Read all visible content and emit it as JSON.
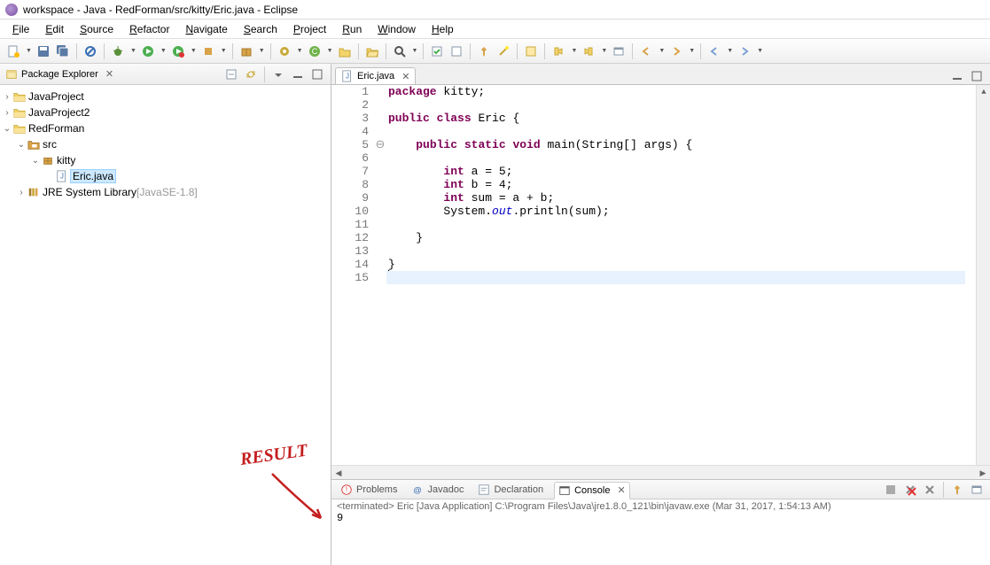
{
  "window": {
    "title": "workspace - Java - RedForman/src/kitty/Eric.java - Eclipse"
  },
  "menu": [
    "File",
    "Edit",
    "Source",
    "Refactor",
    "Navigate",
    "Search",
    "Project",
    "Run",
    "Window",
    "Help"
  ],
  "views": {
    "package_explorer": {
      "title": "Package Explorer"
    }
  },
  "tree": {
    "projects": [
      {
        "name": "JavaProject",
        "expanded": false
      },
      {
        "name": "JavaProject2",
        "expanded": false
      },
      {
        "name": "RedForman",
        "expanded": true,
        "children": [
          {
            "name": "src",
            "type": "srcfolder",
            "expanded": true,
            "children": [
              {
                "name": "kitty",
                "type": "package",
                "expanded": true,
                "children": [
                  {
                    "name": "Eric.java",
                    "type": "cu",
                    "selected": true
                  }
                ]
              }
            ]
          },
          {
            "name": "JRE System Library",
            "lib": "[JavaSE-1.8]",
            "type": "lib",
            "expanded": false
          }
        ]
      }
    ]
  },
  "editor": {
    "tab": "Eric.java",
    "code_lines": [
      {
        "n": 1,
        "tokens": [
          [
            "kw",
            "package"
          ],
          [
            "",
            " kitty;"
          ]
        ]
      },
      {
        "n": 2,
        "tokens": []
      },
      {
        "n": 3,
        "tokens": [
          [
            "kw",
            "public"
          ],
          [
            "",
            " "
          ],
          [
            "kw",
            "class"
          ],
          [
            "",
            " Eric {"
          ]
        ]
      },
      {
        "n": 4,
        "tokens": []
      },
      {
        "n": 5,
        "tokens": [
          [
            "",
            "    "
          ],
          [
            "kw",
            "public"
          ],
          [
            "",
            " "
          ],
          [
            "kw",
            "static"
          ],
          [
            "",
            " "
          ],
          [
            "kw",
            "void"
          ],
          [
            "",
            " main(String[] args) {"
          ]
        ],
        "fold": true
      },
      {
        "n": 6,
        "tokens": []
      },
      {
        "n": 7,
        "tokens": [
          [
            "",
            "        "
          ],
          [
            "kw",
            "int"
          ],
          [
            "",
            " a = 5;"
          ]
        ]
      },
      {
        "n": 8,
        "tokens": [
          [
            "",
            "        "
          ],
          [
            "kw",
            "int"
          ],
          [
            "",
            " b = 4;"
          ]
        ]
      },
      {
        "n": 9,
        "tokens": [
          [
            "",
            "        "
          ],
          [
            "kw",
            "int"
          ],
          [
            "",
            " sum = a + b;"
          ]
        ]
      },
      {
        "n": 10,
        "tokens": [
          [
            "",
            "        System."
          ],
          [
            "field",
            "out"
          ],
          [
            "",
            ".println(sum);"
          ]
        ]
      },
      {
        "n": 11,
        "tokens": []
      },
      {
        "n": 12,
        "tokens": [
          [
            "",
            "    }"
          ]
        ]
      },
      {
        "n": 13,
        "tokens": []
      },
      {
        "n": 14,
        "tokens": [
          [
            "",
            "}"
          ]
        ]
      },
      {
        "n": 15,
        "tokens": [],
        "cursor": true
      }
    ]
  },
  "bottom": {
    "tabs": [
      "Problems",
      "Javadoc",
      "Declaration",
      "Console"
    ],
    "active": "Console",
    "console_meta": "<terminated> Eric [Java Application] C:\\Program Files\\Java\\jre1.8.0_121\\bin\\javaw.exe (Mar 31, 2017, 1:54:13 AM)",
    "console_output": "9"
  },
  "annotation": {
    "text": "RESULT"
  },
  "toolbar_icons": [
    "new",
    "save",
    "saveall",
    "sep",
    "skip",
    "sep",
    "debug",
    "run",
    "runlast",
    "extcfg",
    "sep",
    "newpkg",
    "sep",
    "build",
    "newclass",
    "newfolder",
    "sep",
    "open",
    "sep",
    "search",
    "sep",
    "tasks",
    "toggle",
    "sep",
    "pin",
    "wand",
    "sep",
    "annot",
    "sep",
    "next",
    "prev",
    "showin",
    "sep",
    "back",
    "fwd",
    "sep",
    "back2",
    "fwd2"
  ],
  "pe_icons": [
    "collapse",
    "link",
    "sep",
    "viewmenu",
    "min",
    "max"
  ],
  "console_icons": [
    "termd",
    "removeall",
    "remove",
    "sep",
    "pin",
    "displ"
  ]
}
